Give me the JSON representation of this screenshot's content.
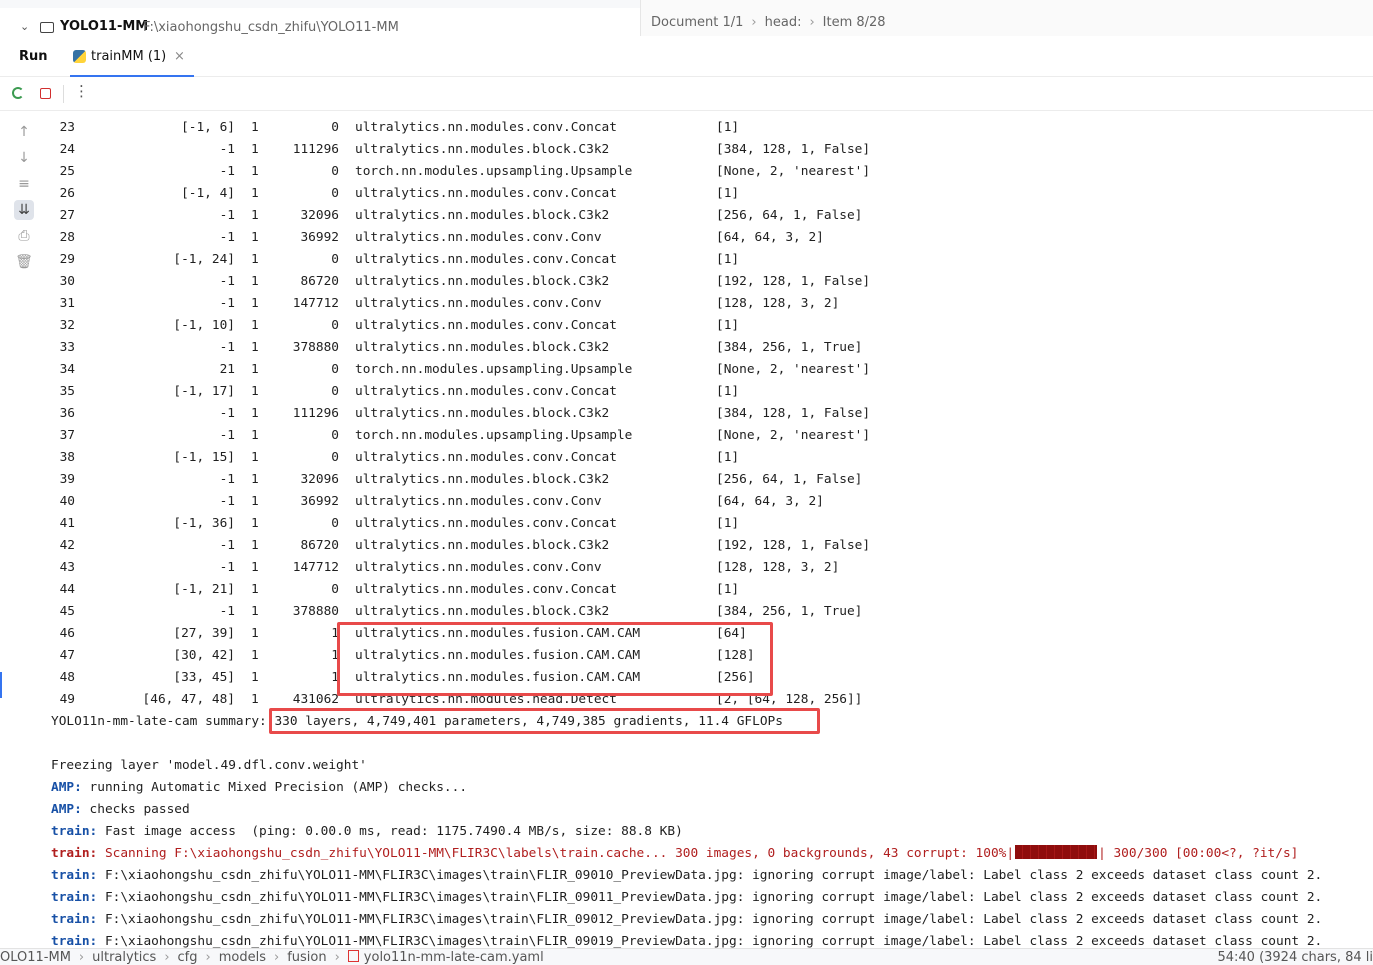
{
  "project": {
    "name": "YOLO11-MM",
    "path": "F:\\xiaohongshu_csdn_zhifu\\YOLO11-MM"
  },
  "breadcrumb_top": {
    "doc": "Document 1/1",
    "head": "head:",
    "item": "Item 8/28"
  },
  "run_panel": {
    "run_label": "Run",
    "tab_label": "trainMM (1)",
    "close": "×"
  },
  "rows": [
    {
      "idx": "23",
      "from": "[-1, 6]",
      "n": "1",
      "params": "0",
      "module": "ultralytics.nn.modules.conv.Concat",
      "args": "[1]"
    },
    {
      "idx": "24",
      "from": "-1",
      "n": "1",
      "params": "111296",
      "module": "ultralytics.nn.modules.block.C3k2",
      "args": "[384, 128, 1, False]"
    },
    {
      "idx": "25",
      "from": "-1",
      "n": "1",
      "params": "0",
      "module": "torch.nn.modules.upsampling.Upsample",
      "args": "[None, 2, 'nearest']"
    },
    {
      "idx": "26",
      "from": "[-1, 4]",
      "n": "1",
      "params": "0",
      "module": "ultralytics.nn.modules.conv.Concat",
      "args": "[1]"
    },
    {
      "idx": "27",
      "from": "-1",
      "n": "1",
      "params": "32096",
      "module": "ultralytics.nn.modules.block.C3k2",
      "args": "[256, 64, 1, False]"
    },
    {
      "idx": "28",
      "from": "-1",
      "n": "1",
      "params": "36992",
      "module": "ultralytics.nn.modules.conv.Conv",
      "args": "[64, 64, 3, 2]"
    },
    {
      "idx": "29",
      "from": "[-1, 24]",
      "n": "1",
      "params": "0",
      "module": "ultralytics.nn.modules.conv.Concat",
      "args": "[1]"
    },
    {
      "idx": "30",
      "from": "-1",
      "n": "1",
      "params": "86720",
      "module": "ultralytics.nn.modules.block.C3k2",
      "args": "[192, 128, 1, False]"
    },
    {
      "idx": "31",
      "from": "-1",
      "n": "1",
      "params": "147712",
      "module": "ultralytics.nn.modules.conv.Conv",
      "args": "[128, 128, 3, 2]"
    },
    {
      "idx": "32",
      "from": "[-1, 10]",
      "n": "1",
      "params": "0",
      "module": "ultralytics.nn.modules.conv.Concat",
      "args": "[1]"
    },
    {
      "idx": "33",
      "from": "-1",
      "n": "1",
      "params": "378880",
      "module": "ultralytics.nn.modules.block.C3k2",
      "args": "[384, 256, 1, True]"
    },
    {
      "idx": "34",
      "from": "21",
      "n": "1",
      "params": "0",
      "module": "torch.nn.modules.upsampling.Upsample",
      "args": "[None, 2, 'nearest']"
    },
    {
      "idx": "35",
      "from": "[-1, 17]",
      "n": "1",
      "params": "0",
      "module": "ultralytics.nn.modules.conv.Concat",
      "args": "[1]"
    },
    {
      "idx": "36",
      "from": "-1",
      "n": "1",
      "params": "111296",
      "module": "ultralytics.nn.modules.block.C3k2",
      "args": "[384, 128, 1, False]"
    },
    {
      "idx": "37",
      "from": "-1",
      "n": "1",
      "params": "0",
      "module": "torch.nn.modules.upsampling.Upsample",
      "args": "[None, 2, 'nearest']"
    },
    {
      "idx": "38",
      "from": "[-1, 15]",
      "n": "1",
      "params": "0",
      "module": "ultralytics.nn.modules.conv.Concat",
      "args": "[1]"
    },
    {
      "idx": "39",
      "from": "-1",
      "n": "1",
      "params": "32096",
      "module": "ultralytics.nn.modules.block.C3k2",
      "args": "[256, 64, 1, False]"
    },
    {
      "idx": "40",
      "from": "-1",
      "n": "1",
      "params": "36992",
      "module": "ultralytics.nn.modules.conv.Conv",
      "args": "[64, 64, 3, 2]"
    },
    {
      "idx": "41",
      "from": "[-1, 36]",
      "n": "1",
      "params": "0",
      "module": "ultralytics.nn.modules.conv.Concat",
      "args": "[1]"
    },
    {
      "idx": "42",
      "from": "-1",
      "n": "1",
      "params": "86720",
      "module": "ultralytics.nn.modules.block.C3k2",
      "args": "[192, 128, 1, False]"
    },
    {
      "idx": "43",
      "from": "-1",
      "n": "1",
      "params": "147712",
      "module": "ultralytics.nn.modules.conv.Conv",
      "args": "[128, 128, 3, 2]"
    },
    {
      "idx": "44",
      "from": "[-1, 21]",
      "n": "1",
      "params": "0",
      "module": "ultralytics.nn.modules.conv.Concat",
      "args": "[1]"
    },
    {
      "idx": "45",
      "from": "-1",
      "n": "1",
      "params": "378880",
      "module": "ultralytics.nn.modules.block.C3k2",
      "args": "[384, 256, 1, True]"
    },
    {
      "idx": "46",
      "from": "[27, 39]",
      "n": "1",
      "params": "1",
      "module": "ultralytics.nn.modules.fusion.CAM.CAM",
      "args": "[64]"
    },
    {
      "idx": "47",
      "from": "[30, 42]",
      "n": "1",
      "params": "1",
      "module": "ultralytics.nn.modules.fusion.CAM.CAM",
      "args": "[128]"
    },
    {
      "idx": "48",
      "from": "[33, 45]",
      "n": "1",
      "params": "1",
      "module": "ultralytics.nn.modules.fusion.CAM.CAM",
      "args": "[256]"
    },
    {
      "idx": "49",
      "from": "[46, 47, 48]",
      "n": "1",
      "params": "431062",
      "module": "ultralytics.nn.modules.head.Detect",
      "args": "[2, [64, 128, 256]]"
    }
  ],
  "summary": {
    "prefix": "YOLO11n-mm-late-cam summary:",
    "text": "330 layers, 4,749,401 parameters, 4,749,385 gradients, 11.4 GFLOPs"
  },
  "log": [
    {
      "tag": "",
      "text": "Freezing layer 'model.49.dfl.conv.weight'",
      "style": "plain"
    },
    {
      "tag": "AMP:",
      "text": " running Automatic Mixed Precision (AMP) checks...",
      "style": "plain"
    },
    {
      "tag": "AMP:",
      "text": " checks passed",
      "style": "plain"
    },
    {
      "tag": "train:",
      "text": " Fast image access  (ping: 0.00.0 ms, read: 1175.7490.4 MB/s, size: 88.8 KB)",
      "style": "plain"
    },
    {
      "tag": "train:",
      "text": " Scanning F:\\xiaohongshu_csdn_zhifu\\YOLO11-MM\\FLIR3C\\labels\\train.cache... 300 images, 0 backgrounds, 43 corrupt: 100%|",
      "tail": "| 300/300 [00:00<?, ?it/s]",
      "style": "red"
    },
    {
      "tag": "train:",
      "text": " F:\\xiaohongshu_csdn_zhifu\\YOLO11-MM\\FLIR3C\\images\\train\\FLIR_09010_PreviewData.jpg: ignoring corrupt image/label: Label class 2 exceeds dataset class count 2.",
      "style": "plain"
    },
    {
      "tag": "train:",
      "text": " F:\\xiaohongshu_csdn_zhifu\\YOLO11-MM\\FLIR3C\\images\\train\\FLIR_09011_PreviewData.jpg: ignoring corrupt image/label: Label class 2 exceeds dataset class count 2.",
      "style": "plain"
    },
    {
      "tag": "train:",
      "text": " F:\\xiaohongshu_csdn_zhifu\\YOLO11-MM\\FLIR3C\\images\\train\\FLIR_09012_PreviewData.jpg: ignoring corrupt image/label: Label class 2 exceeds dataset class count 2.",
      "style": "plain"
    },
    {
      "tag": "train:",
      "text": " F:\\xiaohongshu_csdn_zhifu\\YOLO11-MM\\FLIR3C\\images\\train\\FLIR_09019_PreviewData.jpg: ignoring corrupt image/label: Label class 2 exceeds dataset class count 2.",
      "style": "plain"
    }
  ],
  "status_bar": {
    "crumbs": [
      "OLO11-MM",
      "ultralytics",
      "cfg",
      "models",
      "fusion",
      "yolo11n-mm-late-cam.yaml"
    ],
    "position": "54:40 (3924 chars, 84 li"
  },
  "colors": {
    "accent": "#3574f0",
    "highlight": "#e84a4a",
    "tag_blue": "#1750a6",
    "tag_red": "#b01e1e",
    "progress": "#8f0d0d"
  }
}
